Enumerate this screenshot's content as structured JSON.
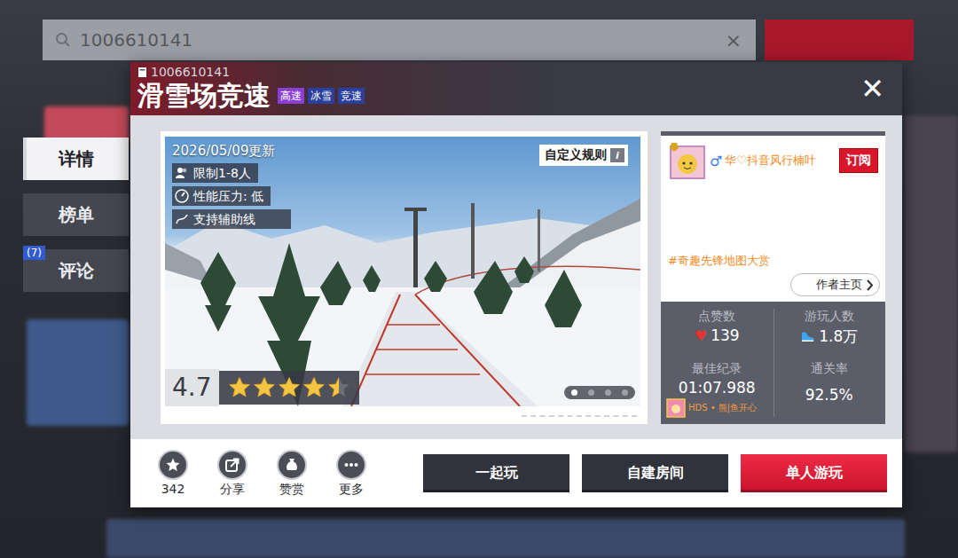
{
  "background": {
    "search_value": "1006610141",
    "clear_icon": "×"
  },
  "side_tabs": [
    {
      "label": "详情",
      "selected": true
    },
    {
      "label": "榜单",
      "selected": false
    },
    {
      "label": "评论",
      "selected": false,
      "badge": "(7)"
    }
  ],
  "map": {
    "id": "1006610141",
    "title": "滑雪场竞速",
    "tags": [
      {
        "label": "高速",
        "color": "#8b3fd9"
      },
      {
        "label": "冰雪",
        "color": "#2a3f9e"
      },
      {
        "label": "竞速",
        "color": "#2a3f9e"
      }
    ]
  },
  "close": "✕",
  "preview": {
    "updated": "2026/05/09更新",
    "players": "限制1-8人",
    "performance": "性能压力: 低",
    "guide": "支持辅助线",
    "rules": "自定义规则",
    "rules_info": "i",
    "rating": "4.7",
    "stars": 4.5,
    "slides": [
      {
        "selected": true
      },
      {
        "selected": false
      },
      {
        "selected": false
      },
      {
        "selected": false
      }
    ]
  },
  "author": {
    "gender": "♂",
    "name": "华♡抖音风行楠叶",
    "subscribe": "订阅",
    "tagline": "#奇趣先锋地图大赏",
    "homepage": "作者主页"
  },
  "stats": {
    "likes": {
      "label": "点赞数",
      "icon": "♥",
      "value": "139"
    },
    "players": {
      "label": "游玩人数",
      "value": "1.8万"
    },
    "record": {
      "label": "最佳纪录",
      "value": "01:07.988",
      "holder": "HDS • 熊|鱼开心"
    },
    "clear_rate": {
      "label": "通关率",
      "value": "92.5%"
    }
  },
  "actions": [
    {
      "label": "342",
      "kind": "favorite"
    },
    {
      "label": "分享",
      "kind": "share"
    },
    {
      "label": "赞赏",
      "kind": "reward"
    },
    {
      "label": "更多",
      "kind": "more"
    }
  ],
  "buttons": [
    {
      "label": "一起玩",
      "primary": false
    },
    {
      "label": "自建房间",
      "primary": false
    },
    {
      "label": "单人游玩",
      "primary": true
    }
  ]
}
